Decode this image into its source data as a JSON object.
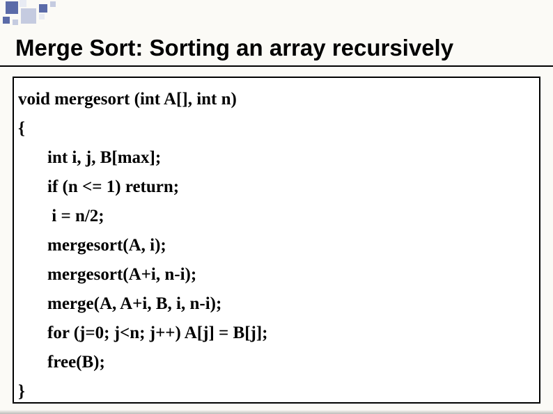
{
  "title": "Merge Sort: Sorting an array recursively",
  "code": {
    "l0": "void mergesort (int A[], int n)",
    "l1": "{",
    "l2": "int i, j, B[max];",
    "l3": "if (n <= 1) return;",
    "l4": " i = n/2;",
    "l5": "mergesort(A, i);",
    "l6": "mergesort(A+i, n-i);",
    "l7": "merge(A, A+i, B, i, n-i);",
    "l8": "for (j=0; j<n; j++) A[j] = B[j];",
    "l9": "free(B);",
    "l10": "}"
  }
}
